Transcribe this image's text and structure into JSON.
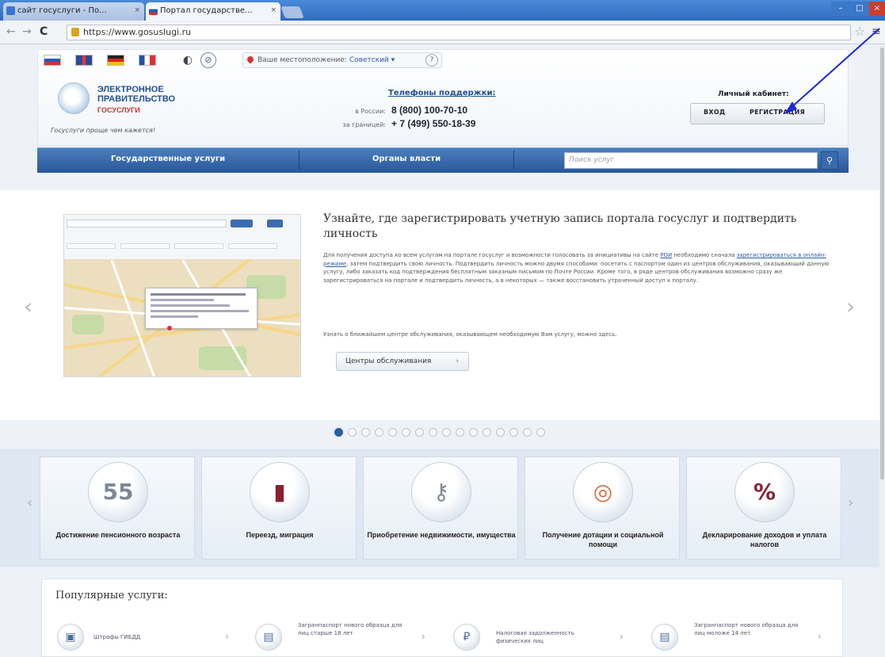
{
  "browser": {
    "tabs": [
      {
        "label": "сайт госуслуги - По..."
      },
      {
        "label": "Портал государстве..."
      }
    ],
    "url": "https://www.gosuslugi.ru"
  },
  "header": {
    "location_label": "Ваше местоположение:",
    "location_city": "Советский ▾",
    "help": "?",
    "logo": {
      "line1": "ЭЛЕКТРОННОЕ",
      "line2": "ПРАВИТЕЛЬСТВО",
      "line3": "ГОСУСЛУГИ",
      "tagline": "Госуслуги проще чем кажется!"
    },
    "phones": {
      "title": "Телефоны поддержки:",
      "russia_label": "в России:",
      "russia_number": "8 (800) 100-70-10",
      "abroad_label": "за границей:",
      "abroad_number": "+ 7 (499) 550-18-39"
    },
    "cabinet": {
      "title": "Личный кабинет:",
      "login": "ВХОД",
      "register": "РЕГИСТРАЦИЯ"
    }
  },
  "nav": {
    "items": [
      {
        "label": "Государственные услуги"
      },
      {
        "label": "Органы власти"
      }
    ],
    "search_placeholder": "Поиск услуг"
  },
  "banner": {
    "title": "Узнайте, где зарегистрировать учетную запись портала госуслуг и подтвердить личность",
    "body_part1": "Для получения доступа ко всем услугам на портале госуслуг и возможности голосовать за инициативы на сайте ",
    "body_link1": "РОИ",
    "body_part2": " необходимо сначала ",
    "body_link2": "зарегистрироваться в онлайн-режиме",
    "body_part3": ", затем подтвердить свою личность. Подтвердить личность можно двумя способами: посетить с паспортом один из центров обслуживания, оказывающий данную услугу, либо заказать код подтверждения бесплатным заказным письмом по Почте России. Кроме того, в ряде центров обслуживания возможно сразу же зарегистрироваться на портале и подтвердить личность, а в некоторых — также восстановить утраченный доступ к порталу.",
    "note": "Узнать о ближайшем центре обслуживания, оказывающем необходимую Вам услугу, можно здесь.",
    "button": "Центры обслуживания",
    "slides_total": 16,
    "slide_active": 1
  },
  "categories": [
    {
      "icon": "calendar-icon",
      "glyph": "55",
      "label": "Достижение пенсионного возраста"
    },
    {
      "icon": "passport-icon",
      "glyph": "▮",
      "label": "Переезд, миграция"
    },
    {
      "icon": "keys-icon",
      "glyph": "⚷",
      "label": "Приобретение недвижимости, имущества"
    },
    {
      "icon": "lifebuoy-icon",
      "glyph": "◎",
      "label": "Получение дотации и социальной помощи"
    },
    {
      "icon": "percent-icon",
      "glyph": "%",
      "label": "Декларирование доходов и уплата налогов"
    }
  ],
  "popular": {
    "title": "Популярные услуги:",
    "items": [
      {
        "icon": "traffic-light-icon",
        "glyph": "▣",
        "label": "Штрафы ГИБДД"
      },
      {
        "icon": "passport-icon",
        "glyph": "▤",
        "label": "Загранпаспорт нового образца для лиц старше 18 лет"
      },
      {
        "icon": "tax-icon",
        "glyph": "₽",
        "label": "Налоговая задолженность физических лиц"
      },
      {
        "icon": "passport-icon",
        "glyph": "▤",
        "label": "Загранпаспорт нового образца для лиц моложе 14 лет"
      }
    ]
  },
  "colors": {
    "brand_blue": "#26579a",
    "accent_red": "#c8352e",
    "link": "#2e5da8",
    "annotation_arrow": "#1a2bd8"
  }
}
